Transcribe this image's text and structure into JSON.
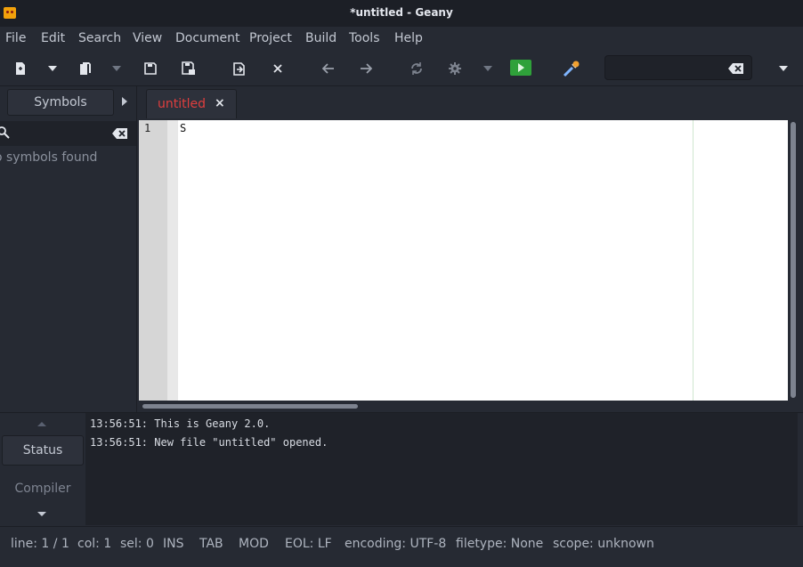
{
  "window": {
    "title": "*untitled - Geany"
  },
  "menu": [
    "File",
    "Edit",
    "Search",
    "View",
    "Document",
    "Project",
    "Build",
    "Tools",
    "Help"
  ],
  "toolbar": {
    "icons": [
      "new-file-icon",
      "new-from-template-icon",
      "open-file-icon",
      "recent-files-icon",
      "save-icon",
      "save-all-icon",
      "revert-icon",
      "close-icon",
      "back-icon",
      "forward-icon",
      "compile-icon",
      "build-icon",
      "build-menu-icon",
      "run-icon",
      "color-chooser-icon",
      "clear-search-icon",
      "toolbar-overflow-icon"
    ],
    "search_value": ""
  },
  "sidebar": {
    "tab_label": "Symbols",
    "search_value": "",
    "empty_message": "o symbols found"
  },
  "tabs": [
    {
      "label": "untitled",
      "modified": true,
      "close": "×"
    }
  ],
  "editor": {
    "lines": [
      {
        "number": "1",
        "text": "S"
      }
    ]
  },
  "messages": {
    "tabs": [
      "Status",
      "Compiler"
    ],
    "lines": [
      "13:56:51: This is Geany 2.0.",
      "13:56:51: New file \"untitled\" opened."
    ]
  },
  "statusbar": {
    "line": "line: 1 / 1",
    "col": "col: 1",
    "sel": "sel: 0",
    "ins": "INS",
    "tab": "TAB",
    "mod": "MOD",
    "eol": "EOL: LF",
    "encoding": "encoding: UTF-8",
    "filetype": "filetype: None",
    "scope": "scope: unknown"
  },
  "colors": {
    "window_bg": "#262a33",
    "titlebar_bg": "#1c1f26",
    "modified_tab_text": "#e03e3e",
    "run_button": "#2fa13a",
    "editor_bg": "#ffffff"
  }
}
